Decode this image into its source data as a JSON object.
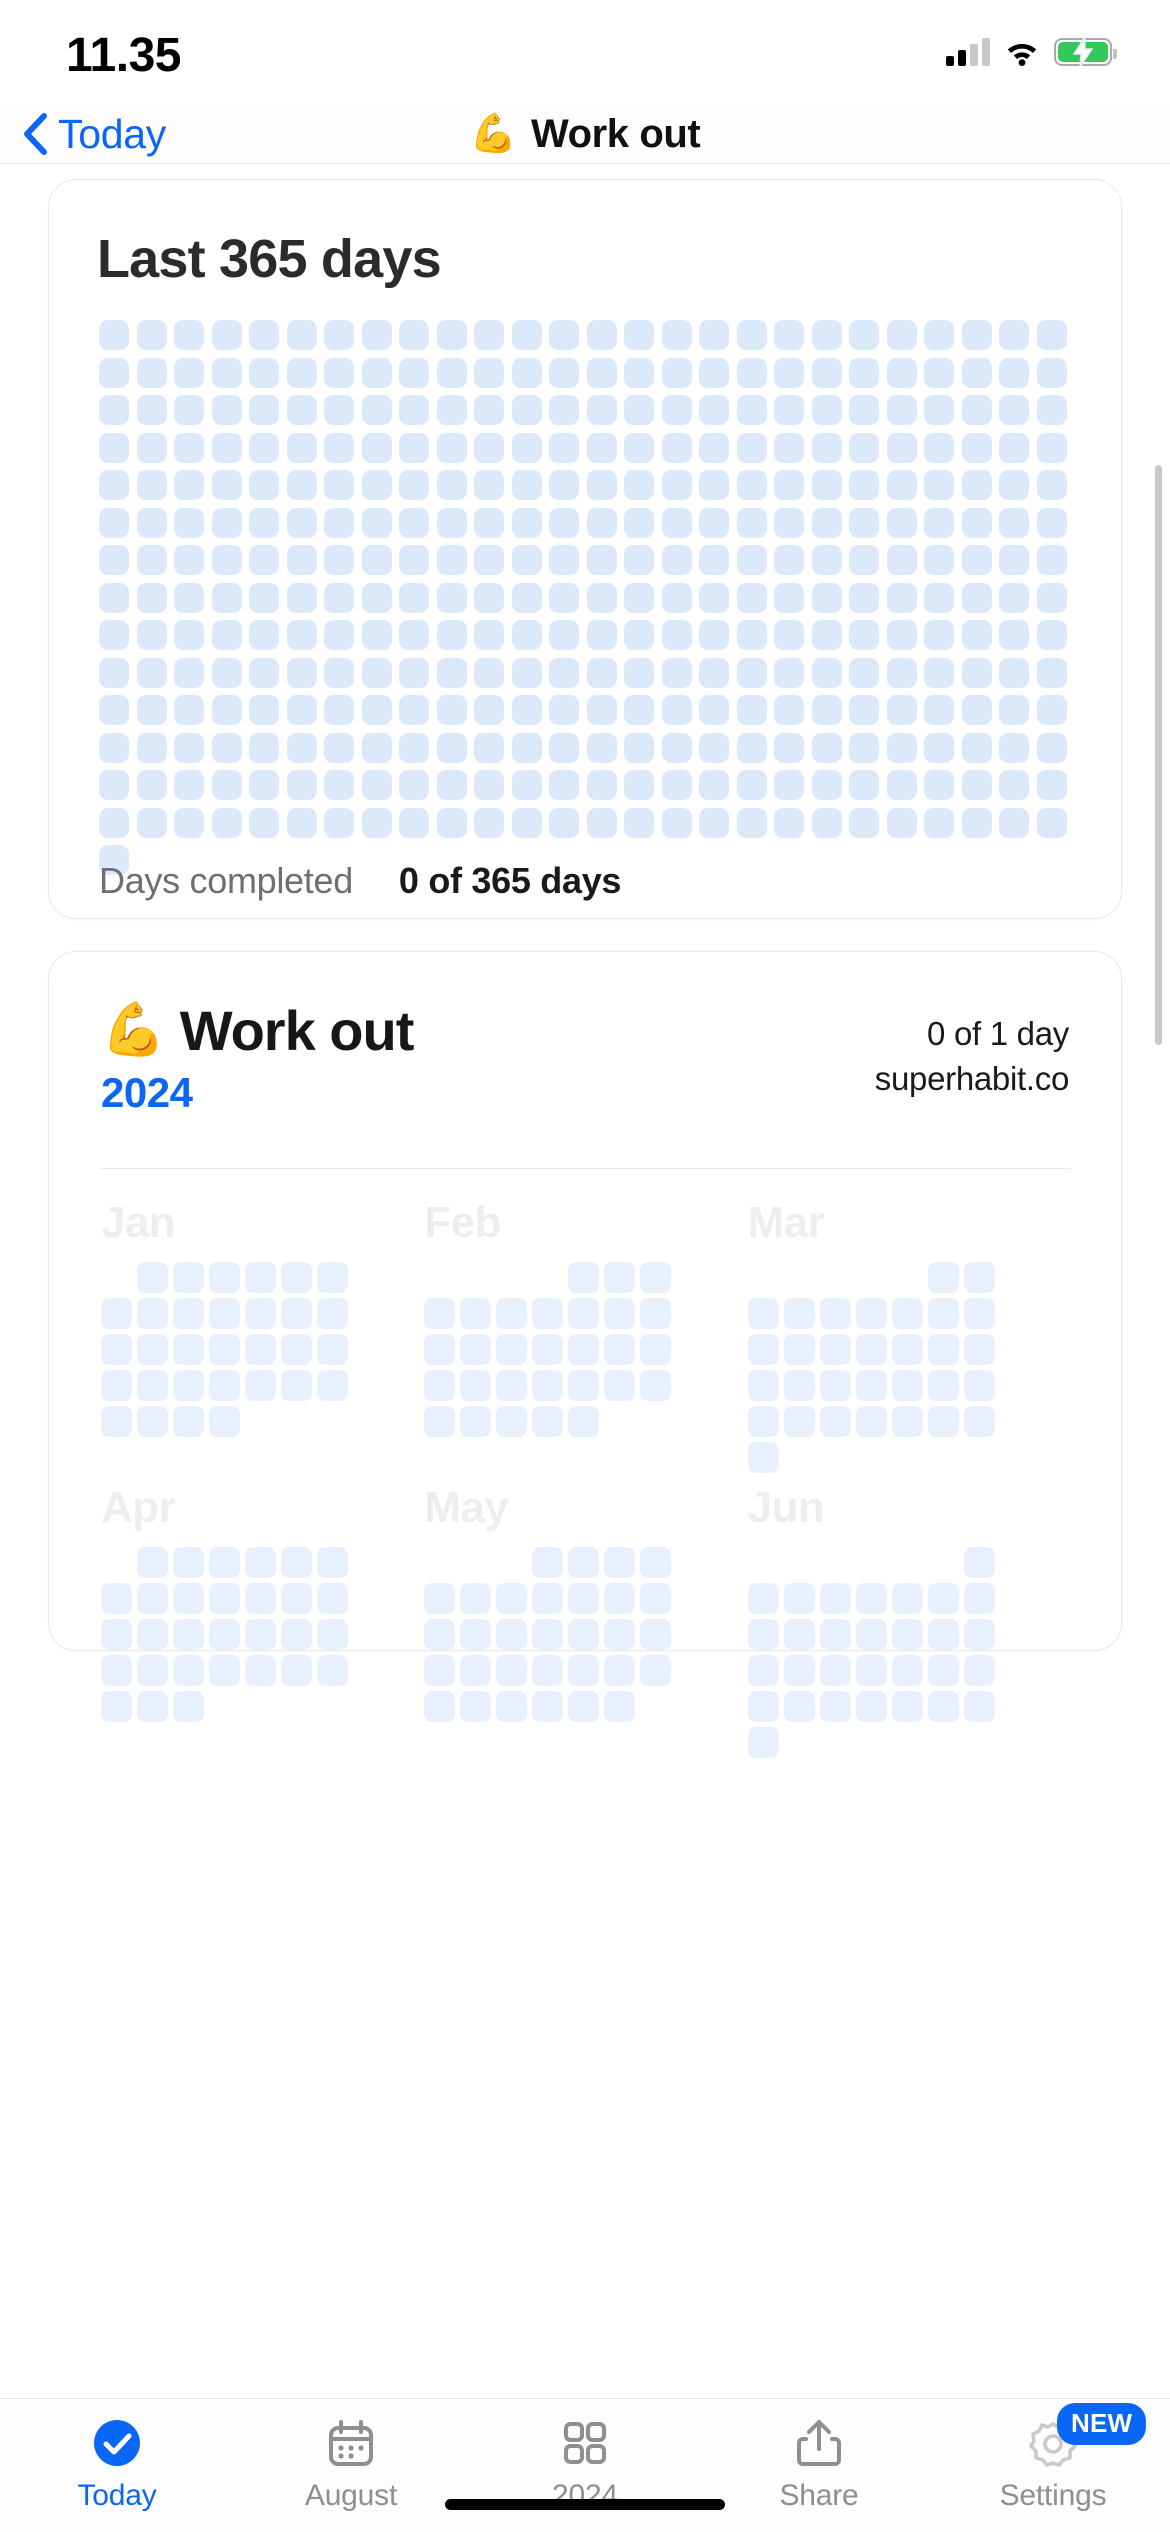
{
  "status_bar": {
    "time": "11.35",
    "dnd_icon": "crescent-moon-icon",
    "signal_icon": "cellular-signal-icon",
    "signal_bars_filled": 2,
    "signal_bars_total": 4,
    "wifi_icon": "wifi-icon",
    "battery_icon": "battery-charging-icon",
    "battery_color": "#34c759"
  },
  "navbar": {
    "back_icon": "chevron-left-icon",
    "back_label": "Today",
    "title_emoji": "💪",
    "title": "Work out",
    "accent_color": "#0a66f5"
  },
  "card_365": {
    "title": "Last 365 days",
    "total_days": 365,
    "completed_days": 0,
    "footer_label": "Days completed",
    "footer_value": "0 of 365 days",
    "dot_color_empty": "#dce9fb",
    "dot_color_done": "#0a66f5",
    "columns": 26
  },
  "card_year": {
    "emoji": "💪",
    "title": "Work out",
    "year": "2024",
    "count_label": "0 of 1 day",
    "site_label": "superhabit.co",
    "months": [
      {
        "name": "Jan",
        "lead_blanks": 1,
        "days": 31,
        "done": []
      },
      {
        "name": "Feb",
        "lead_blanks": 4,
        "days": 29,
        "done": []
      },
      {
        "name": "Mar",
        "lead_blanks": 5,
        "days": 31,
        "done": []
      },
      {
        "name": "Apr",
        "lead_blanks": 1,
        "days": 30,
        "done": []
      },
      {
        "name": "May",
        "lead_blanks": 3,
        "days": 31,
        "done": []
      },
      {
        "name": "Jun",
        "lead_blanks": 6,
        "days": 30,
        "done": []
      }
    ],
    "month_dot_empty": "#e8f0fd",
    "month_name_color": "#eceef1"
  },
  "tabbar": {
    "items": [
      {
        "label": "Today",
        "icon": "check-circle-icon",
        "active": true,
        "badge": null
      },
      {
        "label": "August",
        "icon": "calendar-icon",
        "active": false,
        "badge": null
      },
      {
        "label": "2024",
        "icon": "grid-squares-icon",
        "active": false,
        "badge": null
      },
      {
        "label": "Share",
        "icon": "share-icon",
        "active": false,
        "badge": null
      },
      {
        "label": "Settings",
        "icon": "gear-icon",
        "active": false,
        "badge": "NEW"
      }
    ]
  }
}
